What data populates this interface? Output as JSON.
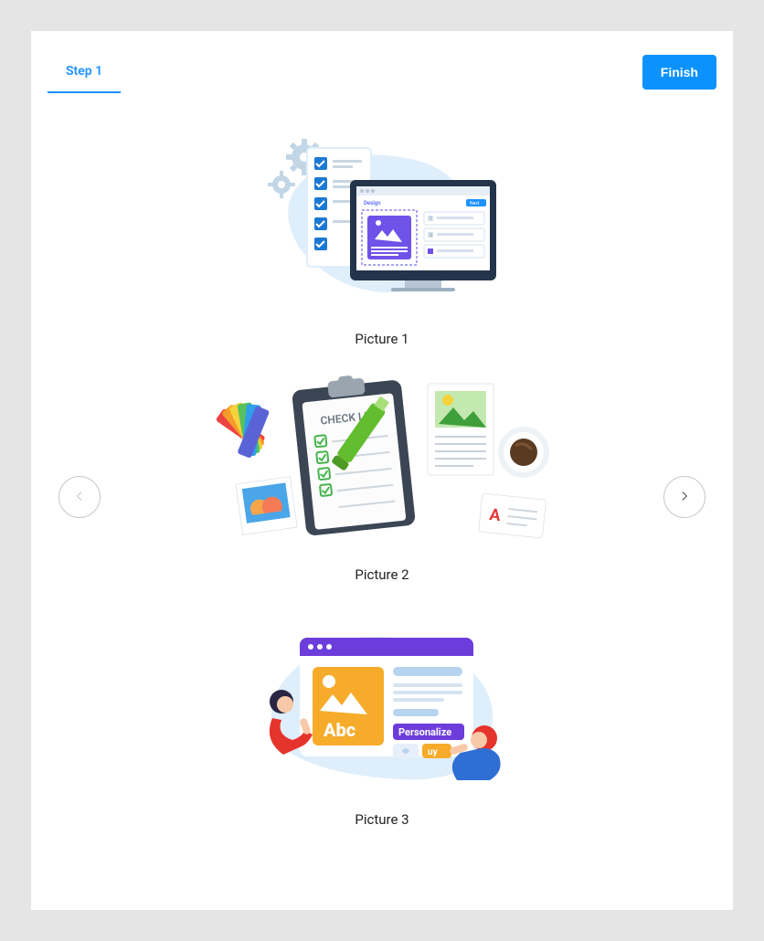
{
  "tabs": {
    "active_label": "Step 1"
  },
  "finish_button": "Finish",
  "items": [
    {
      "label": "Picture 1"
    },
    {
      "label": "Picture 2"
    },
    {
      "label": "Picture 3"
    }
  ],
  "illus2": {
    "clipboard_text": "CHECK LIST",
    "card_letter": "A"
  },
  "illus3": {
    "image_text": "Abc",
    "purple_btn": "Personalize",
    "yellow_btn": "uy"
  }
}
